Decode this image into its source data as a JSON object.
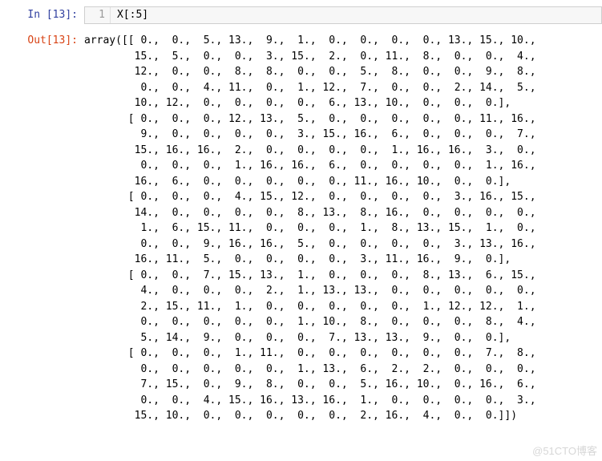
{
  "input": {
    "prompt": "In  [13]:",
    "line_no": "1",
    "code": "X[:5]"
  },
  "output": {
    "prompt": "Out[13]:",
    "text": "array([[ 0.,  0.,  5., 13.,  9.,  1.,  0.,  0.,  0.,  0., 13., 15., 10.,\n        15.,  5.,  0.,  0.,  3., 15.,  2.,  0., 11.,  8.,  0.,  0.,  4.,\n        12.,  0.,  0.,  8.,  8.,  0.,  0.,  5.,  8.,  0.,  0.,  9.,  8.,\n         0.,  0.,  4., 11.,  0.,  1., 12.,  7.,  0.,  0.,  2., 14.,  5.,\n        10., 12.,  0.,  0.,  0.,  0.,  6., 13., 10.,  0.,  0.,  0.],\n       [ 0.,  0.,  0., 12., 13.,  5.,  0.,  0.,  0.,  0.,  0., 11., 16.,\n         9.,  0.,  0.,  0.,  0.,  3., 15., 16.,  6.,  0.,  0.,  0.,  7.,\n        15., 16., 16.,  2.,  0.,  0.,  0.,  0.,  1., 16., 16.,  3.,  0.,\n         0.,  0.,  0.,  1., 16., 16.,  6.,  0.,  0.,  0.,  0.,  1., 16.,\n        16.,  6.,  0.,  0.,  0.,  0.,  0., 11., 16., 10.,  0.,  0.],\n       [ 0.,  0.,  0.,  4., 15., 12.,  0.,  0.,  0.,  0.,  3., 16., 15.,\n        14.,  0.,  0.,  0.,  0.,  8., 13.,  8., 16.,  0.,  0.,  0.,  0.,\n         1.,  6., 15., 11.,  0.,  0.,  0.,  1.,  8., 13., 15.,  1.,  0.,\n         0.,  0.,  9., 16., 16.,  5.,  0.,  0.,  0.,  0.,  3., 13., 16.,\n        16., 11.,  5.,  0.,  0.,  0.,  0.,  3., 11., 16.,  9.,  0.],\n       [ 0.,  0.,  7., 15., 13.,  1.,  0.,  0.,  0.,  8., 13.,  6., 15.,\n         4.,  0.,  0.,  0.,  2.,  1., 13., 13.,  0.,  0.,  0.,  0.,  0.,\n         2., 15., 11.,  1.,  0.,  0.,  0.,  0.,  0.,  1., 12., 12.,  1.,\n         0.,  0.,  0.,  0.,  0.,  1., 10.,  8.,  0.,  0.,  0.,  8.,  4.,\n         5., 14.,  9.,  0.,  0.,  0.,  7., 13., 13.,  9.,  0.,  0.],\n       [ 0.,  0.,  0.,  1., 11.,  0.,  0.,  0.,  0.,  0.,  0.,  7.,  8.,\n         0.,  0.,  0.,  0.,  0.,  1., 13.,  6.,  2.,  2.,  0.,  0.,  0.,\n         7., 15.,  0.,  9.,  8.,  0.,  0.,  5., 16., 10.,  0., 16.,  6.,\n         0.,  0.,  4., 15., 16., 13., 16.,  1.,  0.,  0.,  0.,  0.,  3.,\n        15., 10.,  0.,  0.,  0.,  0.,  0.,  2., 16.,  4.,  0.,  0.]])"
  },
  "watermark": "@51CTO博客"
}
